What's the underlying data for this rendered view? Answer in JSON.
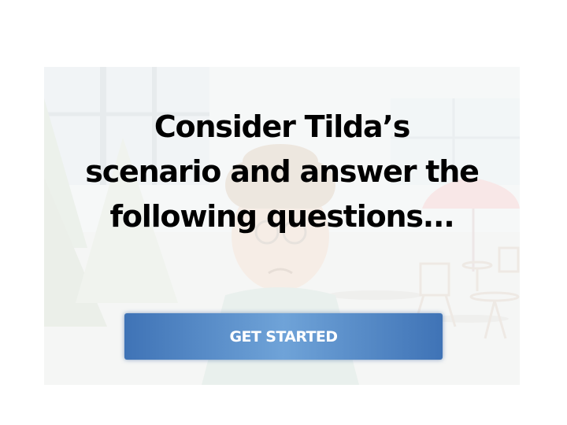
{
  "slide": {
    "heading_line_1": "Consider Tilda’s",
    "heading_line_2": "scenario and answer the",
    "heading_line_3": "following questions...",
    "button_label": "GET STARTED"
  },
  "colors": {
    "button_dark": "#3f73b6",
    "button_light": "#6fa3d8",
    "heading_text": "#000000",
    "button_text": "#ffffff"
  }
}
